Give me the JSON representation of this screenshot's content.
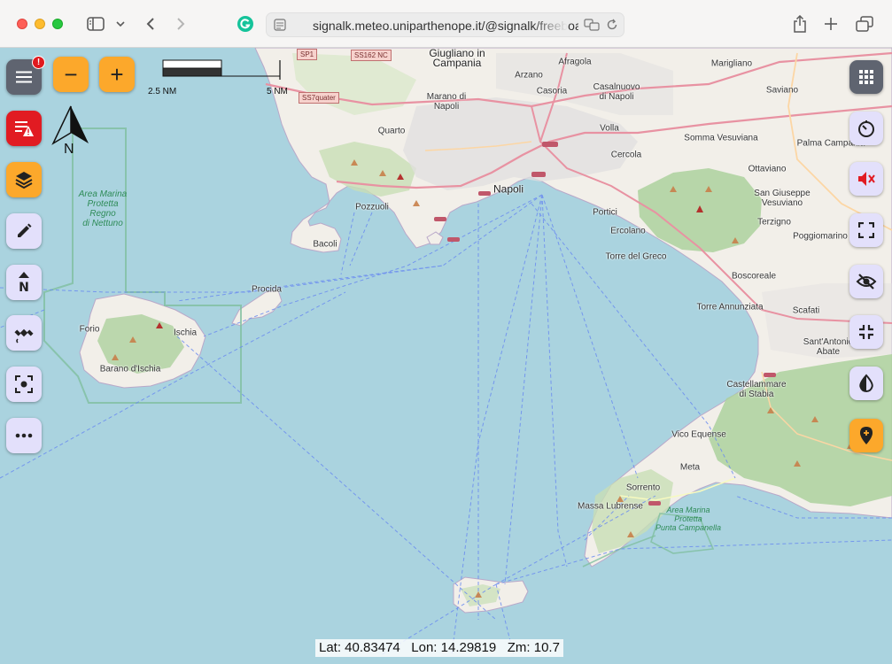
{
  "browser": {
    "url": "signalk.meteo.uniparthenope.it/@signalk/freeboard"
  },
  "toolbar_left": {
    "menu_badge": "!",
    "zoom_out_label": "−",
    "zoom_in_label": "+",
    "north_label": "N"
  },
  "scale": {
    "left_label": "2.5 NM",
    "right_label": "5 NM"
  },
  "status": {
    "lat": "Lat: 40.83474",
    "lon": "Lon: 14.29819",
    "zoom": "Zm: 10.7"
  },
  "map_labels": {
    "giugliano": "Giugliano in\nCampania",
    "afragola": "Afragola",
    "marigliano": "Marigliano",
    "arzano": "Arzano",
    "casoria": "Casoria",
    "casalnuovo": "Casalnuovo\ndi Napoli",
    "saviano": "Saviano",
    "marano": "Marano di\nNapoli",
    "volla": "Volla",
    "quarto": "Quarto",
    "somma": "Somma Vesuviana",
    "palma": "Palma Campania",
    "cercola": "Cercola",
    "ottaviano": "Ottaviano",
    "napoli": "Napoli",
    "pozzuoli": "Pozzuoli",
    "sangiuseppe": "San Giuseppe\nVesuviano",
    "portici": "Portici",
    "terzigno": "Terzigno",
    "poggiomarino": "Poggiomarino",
    "ercolano": "Ercolano",
    "bacoli": "Bacoli",
    "torredelgreco": "Torre del Greco",
    "boscoreale": "Boscoreale",
    "procida": "Procida",
    "torreannunziata": "Torre Annunziata",
    "scafati": "Scafati",
    "forio": "Forio",
    "ischia": "Ischia",
    "santantonio": "Sant'Antonio\nAbate",
    "baranoischia": "Barano d'Ischia",
    "castellammare": "Castellammare\ndi Stabia",
    "vicoequense": "Vico Equense",
    "meta": "Meta",
    "sorrento": "Sorrento",
    "massalubrense": "Massa Lubrense",
    "amp_regno": "Area Marina\nProtetta\nRegno\ndi Nettuno",
    "amp_punta": "Area Marina\nProtetta\nPunta Campanella"
  },
  "road_shields": {
    "sp1": "SP1",
    "ss162nc": "SS162 NC",
    "ss7quater": "SS7quater"
  }
}
